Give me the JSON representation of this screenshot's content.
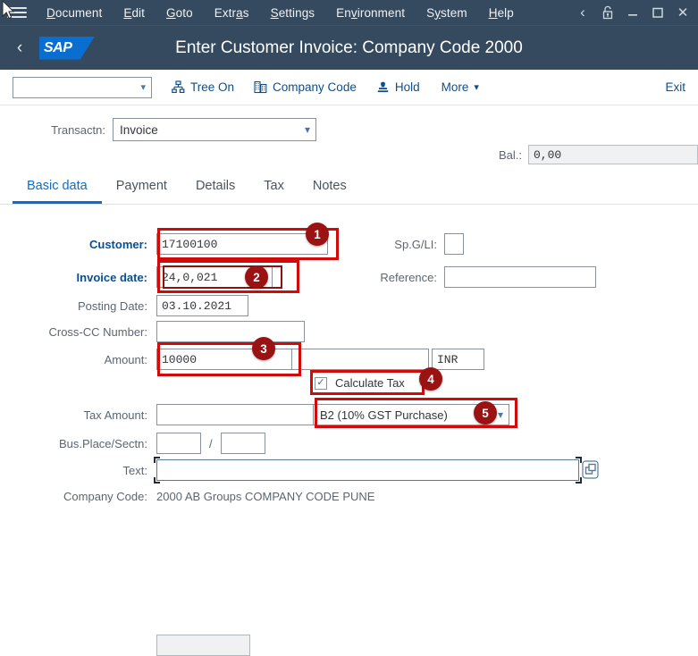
{
  "menubar": {
    "hamburger_icon": "hamburger-menu-icon",
    "items": [
      {
        "label": "Document",
        "accel": "D"
      },
      {
        "label": "Edit",
        "accel": "E"
      },
      {
        "label": "Goto",
        "accel": "G"
      },
      {
        "label": "Extras",
        "accel": "a"
      },
      {
        "label": "Settings",
        "accel": "S"
      },
      {
        "label": "Environment",
        "accel": "v"
      },
      {
        "label": "System",
        "accel": "y"
      },
      {
        "label": "Help",
        "accel": "H"
      }
    ],
    "window_controls": [
      {
        "name": "back-chevron-icon",
        "glyph": "‹"
      },
      {
        "name": "lock-icon",
        "glyph": "⚿"
      },
      {
        "name": "minimize-icon",
        "glyph": "—"
      },
      {
        "name": "maximize-icon",
        "glyph": "☐"
      },
      {
        "name": "close-icon",
        "glyph": "✕"
      }
    ]
  },
  "shell": {
    "back_icon": "back-chevron-icon",
    "logo_text": "SAP",
    "title": "Enter Customer Invoice: Company Code 2000"
  },
  "toolbar": {
    "select_value": "",
    "buttons": [
      {
        "label": "Tree On",
        "icon": "tree-icon"
      },
      {
        "label": "Company Code",
        "icon": "building-icon"
      },
      {
        "label": "Hold",
        "icon": "stamp-icon"
      },
      {
        "label": "More",
        "icon": "chevron-down-icon"
      }
    ],
    "exit_label": "Exit"
  },
  "form": {
    "transaction_label": "Transactn:",
    "transaction_value": "Invoice",
    "balance_label": "Bal.:",
    "balance_value": "0,00",
    "tabs": [
      {
        "label": "Basic data",
        "active": true
      },
      {
        "label": "Payment",
        "active": false
      },
      {
        "label": "Details",
        "active": false
      },
      {
        "label": "Tax",
        "active": false
      },
      {
        "label": "Notes",
        "active": false
      }
    ],
    "customer_label": "Customer:",
    "customer_value": "17100100",
    "spgl_label": "Sp.G/LI:",
    "spgl_value": "",
    "invoice_date_label": "Invoice date:",
    "invoice_date_value": "24,0,021",
    "reference_label": "Reference:",
    "reference_value": "",
    "posting_date_label": "Posting Date:",
    "posting_date_value": "03.10.2021",
    "cross_cc_label": "Cross-CC Number:",
    "cross_cc_value": "",
    "amount_label": "Amount:",
    "amount_value": "10000",
    "amount_extra_value": "",
    "currency_value": "INR",
    "calculate_tax_label": "Calculate Tax",
    "calculate_tax_checked": true,
    "calculate_tax_mark": "✓",
    "tax_amount_label": "Tax Amount:",
    "tax_amount_value": "",
    "tax_code_value": "B2 (10% GST Purchase)",
    "bus_place_label": "Bus.Place/Sectn:",
    "bus_place_value": "",
    "bus_section_value": "",
    "bus_place_separator": "/",
    "text_label": "Text:",
    "text_value": "",
    "text_help_icon": "value-help-icon",
    "company_code_label": "Company Code:",
    "company_code_value": "2000 AB Groups COMPANY CODE PUNE"
  },
  "annotations": {
    "badges": [
      {
        "number": "1",
        "target": "customer-field"
      },
      {
        "number": "2",
        "target": "invoice-date-field"
      },
      {
        "number": "3",
        "target": "amount-field"
      },
      {
        "number": "4",
        "target": "calculate-tax-checkbox"
      },
      {
        "number": "5",
        "target": "tax-code-select"
      }
    ],
    "box_color": "#d10a0a",
    "badge_color": "#9b1212"
  },
  "colors": {
    "shell_bg": "#354a5f",
    "accent": "#0a6ed1",
    "link": "#0a4f8f"
  }
}
